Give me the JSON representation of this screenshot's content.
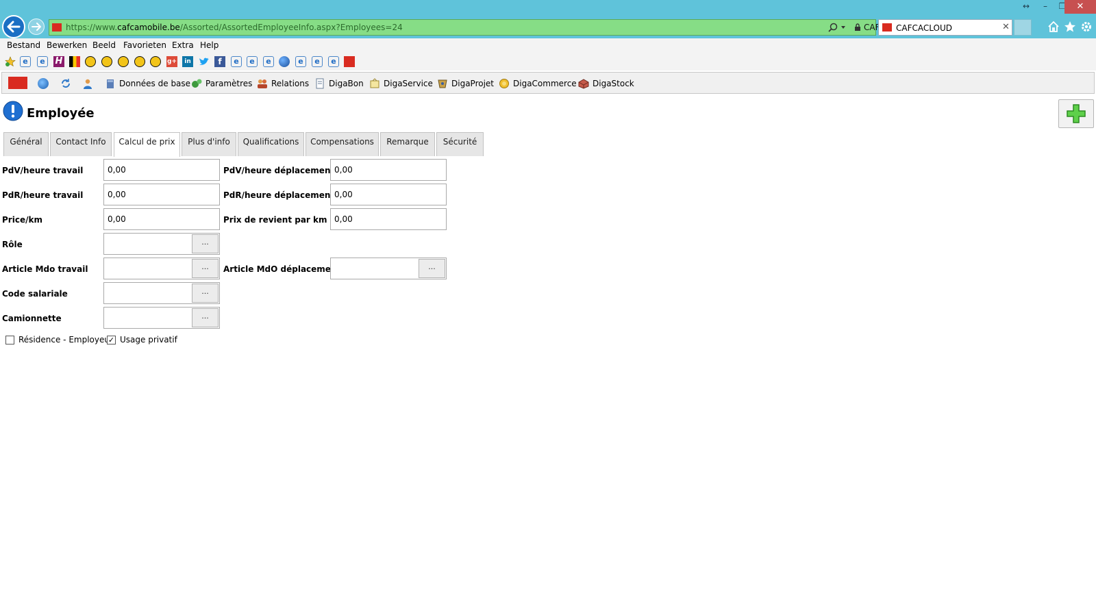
{
  "browser": {
    "url_prefix": "https://www.",
    "url_domain": "cafcamobile.be",
    "url_path": "/Assorted/AssortedEmployeeInfo.aspx?Employees=24",
    "cert_label": "CAFCA [BE]",
    "tab_title": "CAFCACLOUD",
    "menu": [
      "Bestand",
      "Bewerken",
      "Beeld",
      "Favorieten",
      "Extra",
      "Help"
    ]
  },
  "appbar": {
    "items": [
      "Données de base",
      "Paramètres",
      "Relations",
      "DigaBon",
      "DigaService",
      "DigaProjet",
      "DigaCommerce",
      "DigaStock"
    ]
  },
  "page": {
    "title": "Employée",
    "tabs": [
      "Général",
      "Contact Info",
      "Calcul de prix",
      "Plus d'info",
      "Qualifications",
      "Compensations",
      "Remarque",
      "Sécurité"
    ],
    "active_tab": "Calcul de prix"
  },
  "form": {
    "pdv_travail": {
      "label": "PdV/heure travail",
      "value": "0,00"
    },
    "pdv_deplacement": {
      "label": "PdV/heure déplacement",
      "value": "0,00"
    },
    "pdr_travail": {
      "label": "PdR/heure travail",
      "value": "0,00"
    },
    "pdr_deplacement": {
      "label": "PdR/heure déplacement",
      "value": "0,00"
    },
    "price_km": {
      "label": "Price/km",
      "value": "0,00"
    },
    "prix_revient_km": {
      "label": "Prix de revient par km",
      "value": "0,00"
    },
    "role": {
      "label": "Rôle",
      "value": ""
    },
    "article_mdo_travail": {
      "label": "Article Mdo travail",
      "value": ""
    },
    "article_mdo_deplacement": {
      "label": "Article MdO déplacement",
      "value": ""
    },
    "code_salariale": {
      "label": "Code salariale",
      "value": ""
    },
    "camionnette": {
      "label": "Camionnette",
      "value": ""
    },
    "lookup_button_label": "...",
    "residence_employeur": {
      "label": "Résidence - Employeur",
      "checked": false
    },
    "usage_privatif": {
      "label": "Usage privatif",
      "checked": true
    }
  }
}
